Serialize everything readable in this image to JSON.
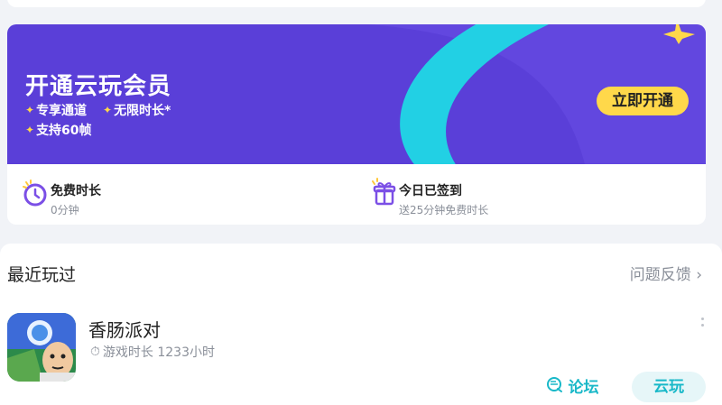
{
  "vip": {
    "title": "开通云玩会员",
    "features": [
      "专享通道",
      "无限时长*",
      "支持60帧"
    ],
    "open_label": "立即开通"
  },
  "stats": {
    "free_time": {
      "label": "免费时长",
      "value": "0分钟",
      "icon": "clock-icon"
    },
    "checkin": {
      "label": "今日已签到",
      "sub": "送25分钟免费时长",
      "icon": "gift-icon"
    }
  },
  "recent": {
    "title": "最近玩过",
    "feedback_label": "问题反馈",
    "games": [
      {
        "name": "香肠派对",
        "playtime": "游戏时长 1233小时",
        "forum_label": "论坛",
        "cloud_label": "云玩"
      }
    ]
  },
  "colors": {
    "banner": "#5a3fd8",
    "accent_yellow": "#ffd84a",
    "accent_teal": "#18b8c8"
  }
}
